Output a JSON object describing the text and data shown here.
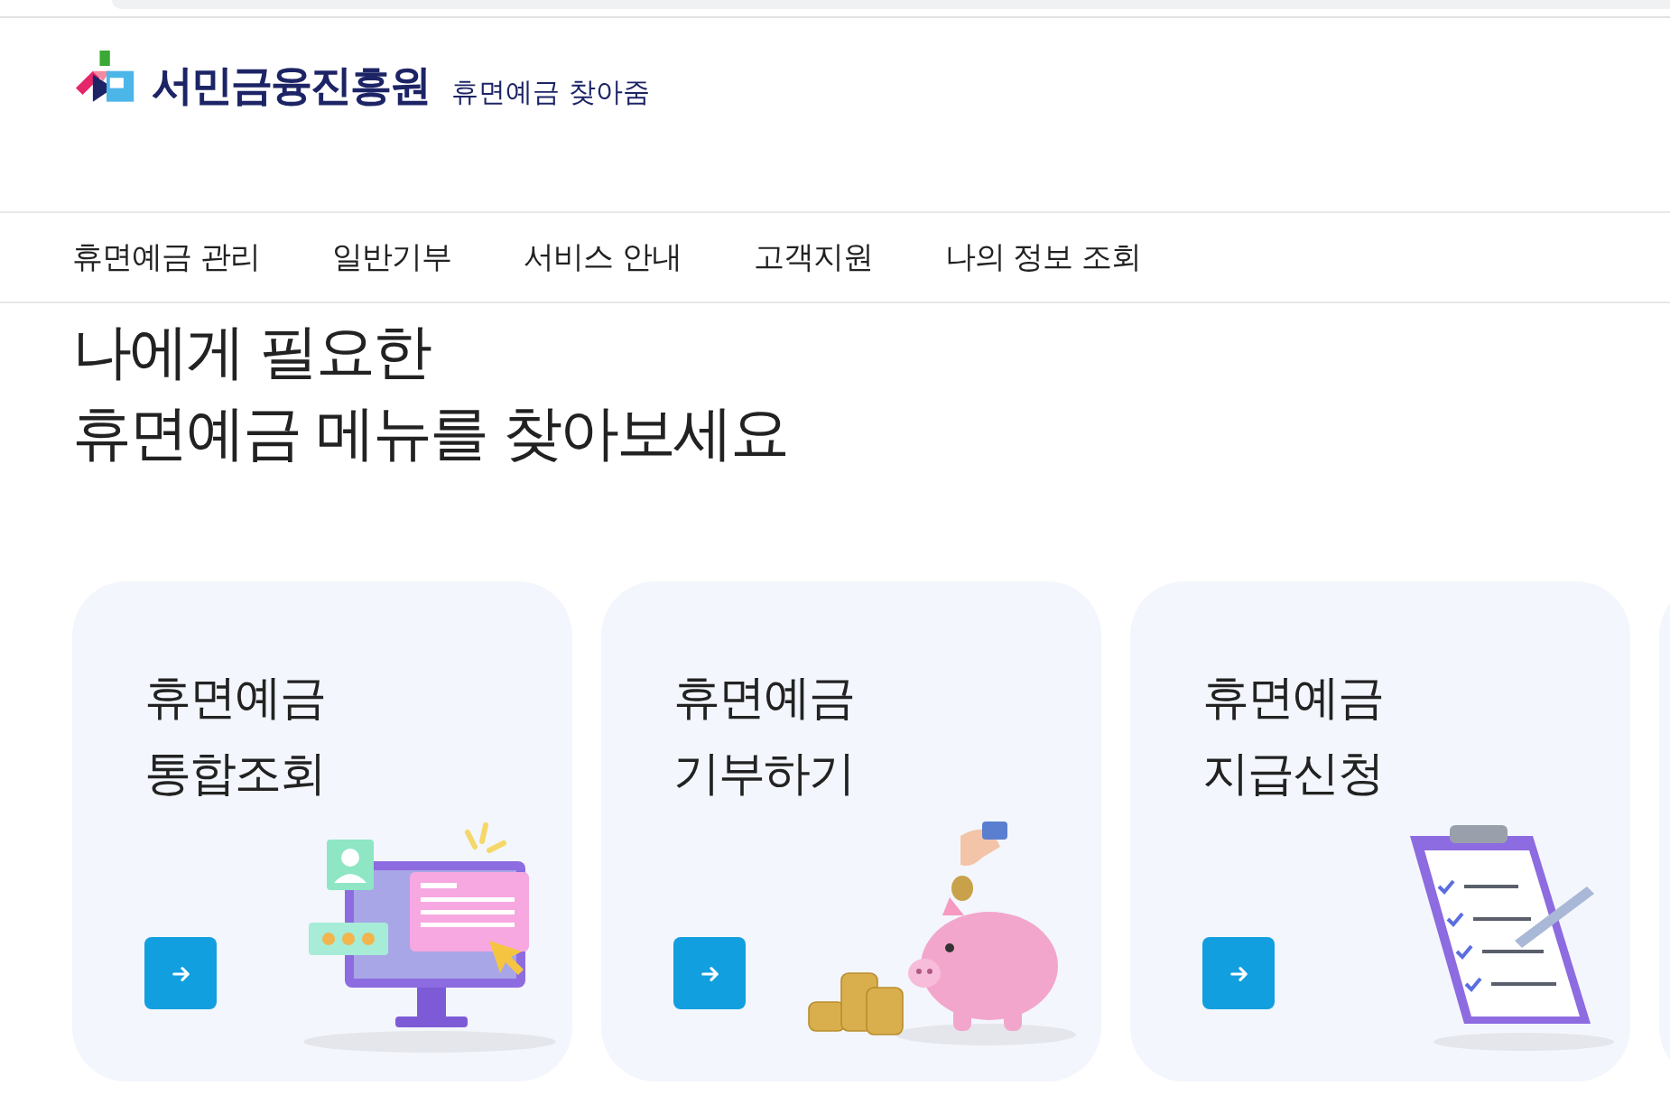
{
  "header": {
    "logo_text": "서민금융진흥원",
    "service_name": "휴면예금 찾아줌"
  },
  "nav": {
    "items": [
      {
        "label": "휴면예금 관리"
      },
      {
        "label": "일반기부"
      },
      {
        "label": "서비스 안내"
      },
      {
        "label": "고객지원"
      },
      {
        "label": "나의 정보 조회"
      }
    ]
  },
  "hero": {
    "lines": [
      "나에게 필요한",
      "휴면예금 메뉴를 찾아보세요"
    ]
  },
  "cards": [
    {
      "kind": "monitor",
      "title_lines": [
        "휴면예금",
        "통합조회"
      ]
    },
    {
      "kind": "piggy",
      "title_lines": [
        "휴면예금",
        "기부하기"
      ]
    },
    {
      "kind": "clipboard",
      "title_lines": [
        "휴면예금",
        "지급신청"
      ]
    }
  ]
}
